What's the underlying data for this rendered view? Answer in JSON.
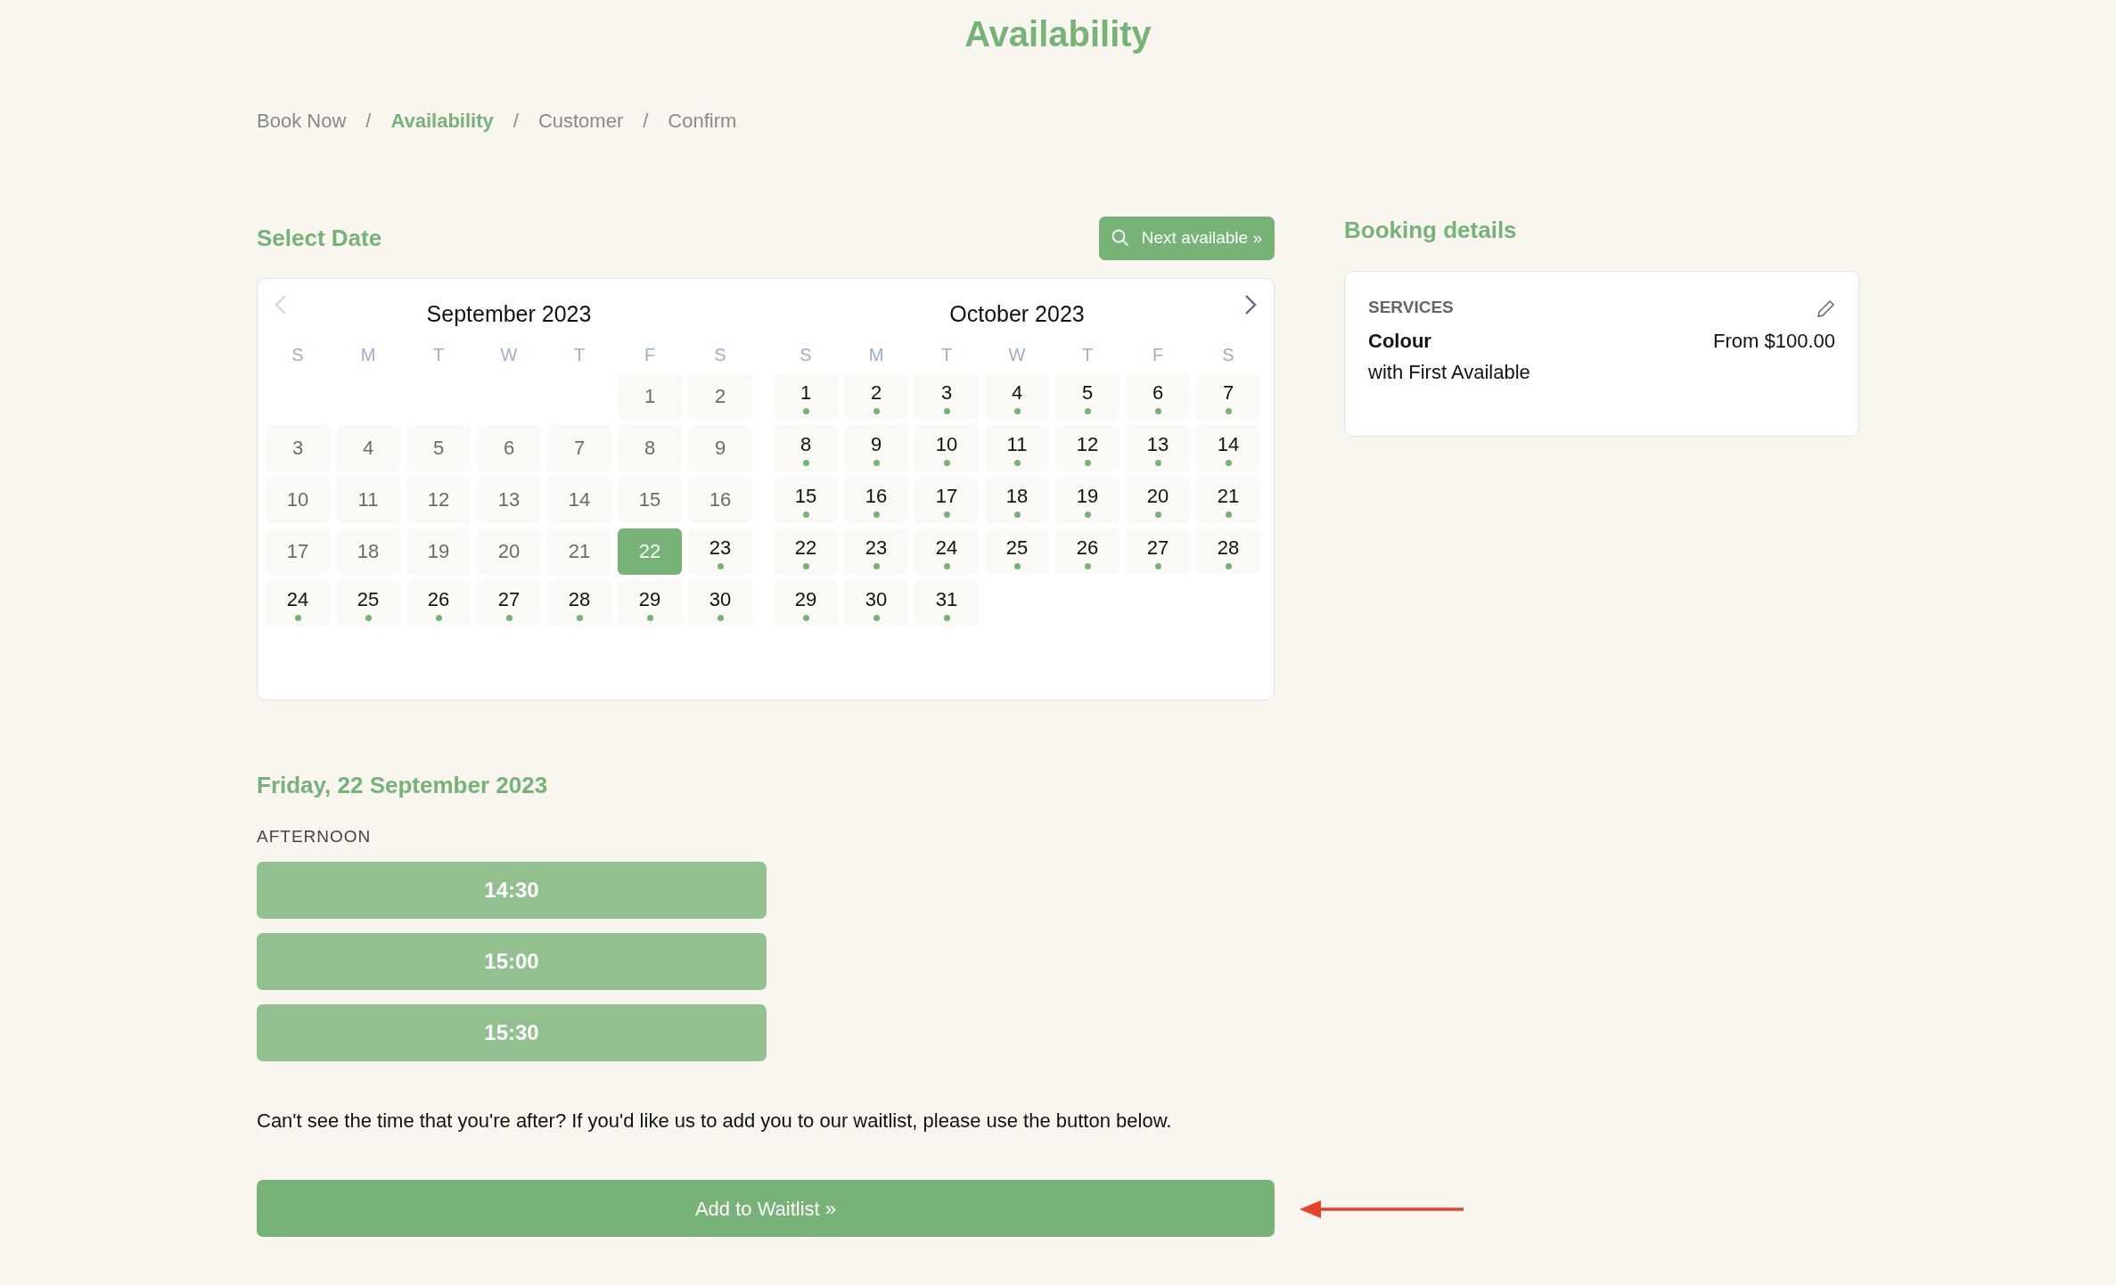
{
  "title": "Availability",
  "breadcrumb": {
    "separator": "/",
    "items": [
      {
        "label": "Book Now",
        "selected": false
      },
      {
        "label": "Availability",
        "selected": true
      },
      {
        "label": "Customer",
        "selected": false
      },
      {
        "label": "Confirm",
        "selected": false
      }
    ]
  },
  "select_date": {
    "heading": "Select Date",
    "next_button": "Next available »",
    "prev_disabled": true,
    "next_disabled": false,
    "months": [
      {
        "title": "September 2023",
        "weekdays": [
          "S",
          "M",
          "T",
          "W",
          "T",
          "F",
          "S"
        ],
        "days": [
          {
            "kind": "blank"
          },
          {
            "kind": "blank"
          },
          {
            "kind": "blank"
          },
          {
            "kind": "blank"
          },
          {
            "kind": "blank"
          },
          {
            "kind": "day",
            "day": "1",
            "available": false,
            "selected": false
          },
          {
            "kind": "day",
            "day": "2",
            "available": false,
            "selected": false
          },
          {
            "kind": "day",
            "day": "3",
            "available": false,
            "selected": false
          },
          {
            "kind": "day",
            "day": "4",
            "available": false,
            "selected": false
          },
          {
            "kind": "day",
            "day": "5",
            "available": false,
            "selected": false
          },
          {
            "kind": "day",
            "day": "6",
            "available": false,
            "selected": false
          },
          {
            "kind": "day",
            "day": "7",
            "available": false,
            "selected": false
          },
          {
            "kind": "day",
            "day": "8",
            "available": false,
            "selected": false
          },
          {
            "kind": "day",
            "day": "9",
            "available": false,
            "selected": false
          },
          {
            "kind": "day",
            "day": "10",
            "available": false,
            "selected": false
          },
          {
            "kind": "day",
            "day": "11",
            "available": false,
            "selected": false
          },
          {
            "kind": "day",
            "day": "12",
            "available": false,
            "selected": false
          },
          {
            "kind": "day",
            "day": "13",
            "available": false,
            "selected": false
          },
          {
            "kind": "day",
            "day": "14",
            "available": false,
            "selected": false
          },
          {
            "kind": "day",
            "day": "15",
            "available": false,
            "selected": false
          },
          {
            "kind": "day",
            "day": "16",
            "available": false,
            "selected": false
          },
          {
            "kind": "day",
            "day": "17",
            "available": false,
            "selected": false
          },
          {
            "kind": "day",
            "day": "18",
            "available": false,
            "selected": false
          },
          {
            "kind": "day",
            "day": "19",
            "available": false,
            "selected": false
          },
          {
            "kind": "day",
            "day": "20",
            "available": false,
            "selected": false
          },
          {
            "kind": "day",
            "day": "21",
            "available": false,
            "selected": false
          },
          {
            "kind": "day",
            "day": "22",
            "available": true,
            "selected": true
          },
          {
            "kind": "day",
            "day": "23",
            "available": true,
            "selected": false
          },
          {
            "kind": "day",
            "day": "24",
            "available": true,
            "selected": false
          },
          {
            "kind": "day",
            "day": "25",
            "available": true,
            "selected": false
          },
          {
            "kind": "day",
            "day": "26",
            "available": true,
            "selected": false
          },
          {
            "kind": "day",
            "day": "27",
            "available": true,
            "selected": false
          },
          {
            "kind": "day",
            "day": "28",
            "available": true,
            "selected": false
          },
          {
            "kind": "day",
            "day": "29",
            "available": true,
            "selected": false
          },
          {
            "kind": "day",
            "day": "30",
            "available": true,
            "selected": false
          }
        ]
      },
      {
        "title": "October 2023",
        "weekdays": [
          "S",
          "M",
          "T",
          "W",
          "T",
          "F",
          "S"
        ],
        "days": [
          {
            "kind": "day",
            "day": "1",
            "available": true,
            "selected": false
          },
          {
            "kind": "day",
            "day": "2",
            "available": true,
            "selected": false
          },
          {
            "kind": "day",
            "day": "3",
            "available": true,
            "selected": false
          },
          {
            "kind": "day",
            "day": "4",
            "available": true,
            "selected": false
          },
          {
            "kind": "day",
            "day": "5",
            "available": true,
            "selected": false
          },
          {
            "kind": "day",
            "day": "6",
            "available": true,
            "selected": false
          },
          {
            "kind": "day",
            "day": "7",
            "available": true,
            "selected": false
          },
          {
            "kind": "day",
            "day": "8",
            "available": true,
            "selected": false
          },
          {
            "kind": "day",
            "day": "9",
            "available": true,
            "selected": false
          },
          {
            "kind": "day",
            "day": "10",
            "available": true,
            "selected": false
          },
          {
            "kind": "day",
            "day": "11",
            "available": true,
            "selected": false
          },
          {
            "kind": "day",
            "day": "12",
            "available": true,
            "selected": false
          },
          {
            "kind": "day",
            "day": "13",
            "available": true,
            "selected": false
          },
          {
            "kind": "day",
            "day": "14",
            "available": true,
            "selected": false
          },
          {
            "kind": "day",
            "day": "15",
            "available": true,
            "selected": false
          },
          {
            "kind": "day",
            "day": "16",
            "available": true,
            "selected": false
          },
          {
            "kind": "day",
            "day": "17",
            "available": true,
            "selected": false
          },
          {
            "kind": "day",
            "day": "18",
            "available": true,
            "selected": false
          },
          {
            "kind": "day",
            "day": "19",
            "available": true,
            "selected": false
          },
          {
            "kind": "day",
            "day": "20",
            "available": true,
            "selected": false
          },
          {
            "kind": "day",
            "day": "21",
            "available": true,
            "selected": false
          },
          {
            "kind": "day",
            "day": "22",
            "available": true,
            "selected": false
          },
          {
            "kind": "day",
            "day": "23",
            "available": true,
            "selected": false
          },
          {
            "kind": "day",
            "day": "24",
            "available": true,
            "selected": false
          },
          {
            "kind": "day",
            "day": "25",
            "available": true,
            "selected": false
          },
          {
            "kind": "day",
            "day": "26",
            "available": true,
            "selected": false
          },
          {
            "kind": "day",
            "day": "27",
            "available": true,
            "selected": false
          },
          {
            "kind": "day",
            "day": "28",
            "available": true,
            "selected": false
          },
          {
            "kind": "day",
            "day": "29",
            "available": true,
            "selected": false
          },
          {
            "kind": "day",
            "day": "30",
            "available": true,
            "selected": false
          },
          {
            "kind": "day",
            "day": "31",
            "available": true,
            "selected": false
          }
        ]
      }
    ]
  },
  "times": {
    "date_heading": "Friday, 22 September 2023",
    "period": "AFTERNOON",
    "slots": [
      "14:30",
      "15:00",
      "15:30"
    ]
  },
  "waitlist": {
    "text": "Can't see the time that you're after? If you'd like us to add you to our waitlist, please use the button below.",
    "button": "Add to Waitlist »"
  },
  "booking_details": {
    "heading": "Booking details",
    "section_label": "SERVICES",
    "service": "Colour",
    "staff": "with First Available",
    "price": "From $100.00"
  }
}
